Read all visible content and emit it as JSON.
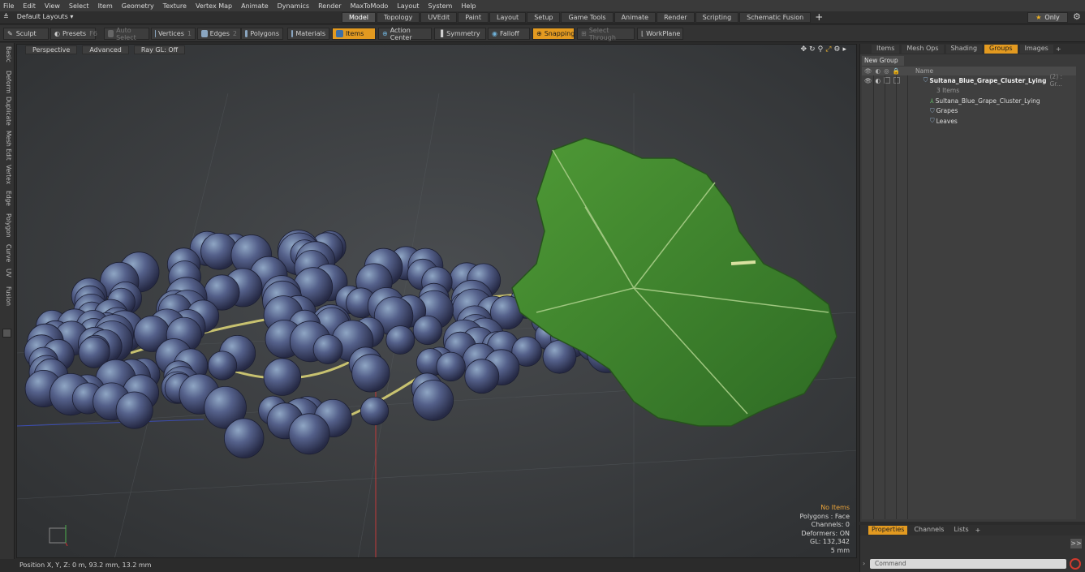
{
  "menu": [
    "File",
    "Edit",
    "View",
    "Select",
    "Item",
    "Geometry",
    "Texture",
    "Vertex Map",
    "Animate",
    "Dynamics",
    "Render",
    "MaxToModo",
    "Layout",
    "System",
    "Help"
  ],
  "layout_selector": "Default Layouts ▾",
  "layout_tabs": [
    "Model",
    "Topology",
    "UVEdit",
    "Paint",
    "Layout",
    "Setup",
    "Game Tools",
    "Animate",
    "Render",
    "Scripting",
    "Schematic Fusion"
  ],
  "active_layout_tab": "Model",
  "only_label": "Only",
  "toolbar": {
    "sculpt": "Sculpt",
    "presets": "Presets",
    "presets_key": "F6",
    "auto_select": "Auto Select",
    "vertices": "Vertices",
    "vertices_num": "1",
    "edges": "Edges",
    "edges_num": "2",
    "polygons": "Polygons",
    "materials": "Materials",
    "items": "Items",
    "action_center": "Action Center",
    "symmetry": "Symmetry",
    "falloff": "Falloff",
    "snapping": "Snapping",
    "select_through": "Select Through",
    "workplane": "WorkPlane"
  },
  "left_tabs": [
    "Basic",
    "Deform",
    "Duplicate",
    "Mesh Edit",
    "Vertex",
    "Edge",
    "Polygon",
    "Curve",
    "UV",
    "Fusion"
  ],
  "viewport": {
    "perspective": "Perspective",
    "advanced": "Advanced",
    "raygl": "Ray GL: Off"
  },
  "stats": {
    "no_items": "No Items",
    "polygons": "Polygons : Face",
    "channels": "Channels: 0",
    "deformers": "Deformers: ON",
    "gl": "GL: 132,342",
    "scale": "5 mm"
  },
  "status": "Position X, Y, Z:  0 m, 93.2 mm, 13.2 mm",
  "right_panel": {
    "tabs": [
      "Items",
      "Mesh Ops",
      "Shading",
      "Groups",
      "Images"
    ],
    "active_tab": "Groups",
    "new_group": "New Group",
    "name_header": "Name",
    "group_name": "Sultana_Blue_Grape_Cluster_Lying",
    "group_suffix": "(2) : Gr...",
    "group_count": "3 Items",
    "children": [
      "Sultana_Blue_Grape_Cluster_Lying",
      "Grapes",
      "Leaves"
    ]
  },
  "bottom_panel": {
    "tabs": [
      "Properties",
      "Channels",
      "Lists"
    ],
    "active_tab": "Properties",
    "command_placeholder": "Command",
    "expand": ">>"
  }
}
